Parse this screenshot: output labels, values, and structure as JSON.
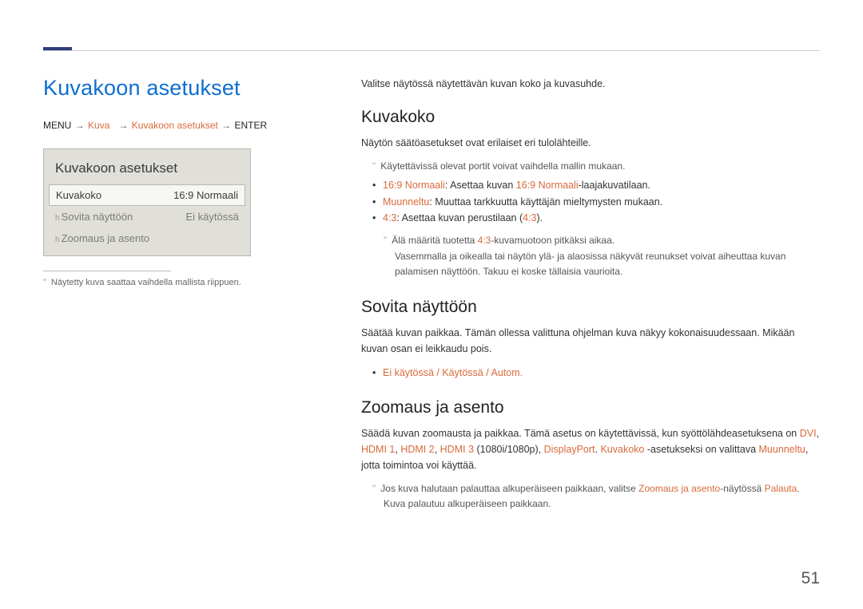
{
  "page_number": "51",
  "title": "Kuvakoon asetukset",
  "breadcrumb": {
    "menu": "MENU",
    "arrow": "→",
    "p1": "Kuva",
    "p2": "Kuvakoon asetukset",
    "enter": "ENTER"
  },
  "panel": {
    "heading": "Kuvakoon asetukset",
    "rows": [
      {
        "label": "Kuvakoko",
        "value": "16:9 Normaali"
      },
      {
        "label": "Sovita näyttöön",
        "value": "Ei käytössä"
      },
      {
        "label": "Zoomaus ja asento",
        "value": ""
      }
    ]
  },
  "left_footnote": "Näytetty kuva saattaa vaihdella mallista riippuen.",
  "intro": "Valitse näytössä näytettävän kuvan koko ja kuvasuhde.",
  "sec1": {
    "heading": "Kuvakoko",
    "line1": "Näytön säätöasetukset ovat erilaiset eri tulolähteille.",
    "note1": "Käytettävissä olevat portit voivat vaihdella mallin mukaan.",
    "bul1a": "16:9 Normaali",
    "bul1b": ": Asettaa kuvan ",
    "bul1c": "16:9 Normaali",
    "bul1d": "-laajakuvatilaan.",
    "bul2a": "Muunneltu",
    "bul2b": ": Muuttaa tarkkuutta käyttäjän mieltymysten mukaan.",
    "bul3a": "4:3",
    "bul3b": ": Asettaa kuvan perustilaan (",
    "bul3c": "4:3",
    "bul3d": ").",
    "subnote1a": "Älä määritä tuotetta ",
    "subnote1b": "4:3",
    "subnote1c": "-kuvamuotoon pitkäksi aikaa.",
    "subnote2": "Vasemmalla ja oikealla tai näytön ylä- ja alaosissa näkyvät reunukset voivat aiheuttaa kuvan palamisen näyttöön. Takuu ei koske tällaisia vaurioita."
  },
  "sec2": {
    "heading": "Sovita näyttöön",
    "para": "Säätää kuvan paikkaa. Tämän ollessa valittuna ohjelman kuva näkyy kokonaisuudessaan. Mikään kuvan osan ei leikkaudu pois.",
    "opt_a": "Ei käytössä",
    "opt_b": "Käytössä",
    "opt_c": "Autom.",
    "sep": " / "
  },
  "sec3": {
    "heading": "Zoomaus ja asento",
    "para_a": "Säädä kuvan zoomausta ja paikkaa. Tämä asetus on käytettävissä, kun syöttölähdeasetuksena on ",
    "dvi": "DVI",
    "c1": ", ",
    "h1": "HDMI 1",
    "c2": ", ",
    "h2": "HDMI 2",
    "c3": ", ",
    "h3": "HDMI 3",
    "res": " (1080i/1080p), ",
    "dp": "DisplayPort",
    "dot": ". ",
    "kk": "Kuvakoko",
    "mid": " -asetukseksi on valittava ",
    "mu": "Muunneltu",
    "end": ", jotta toimintoa voi käyttää.",
    "note_a": "Jos kuva halutaan palauttaa alkuperäiseen paikkaan, valitse ",
    "note_b": "Zoomaus ja asento",
    "note_c": "-näytössä ",
    "note_d": "Palauta",
    "note_e": ". Kuva palautuu alkuperäiseen paikkaan."
  }
}
